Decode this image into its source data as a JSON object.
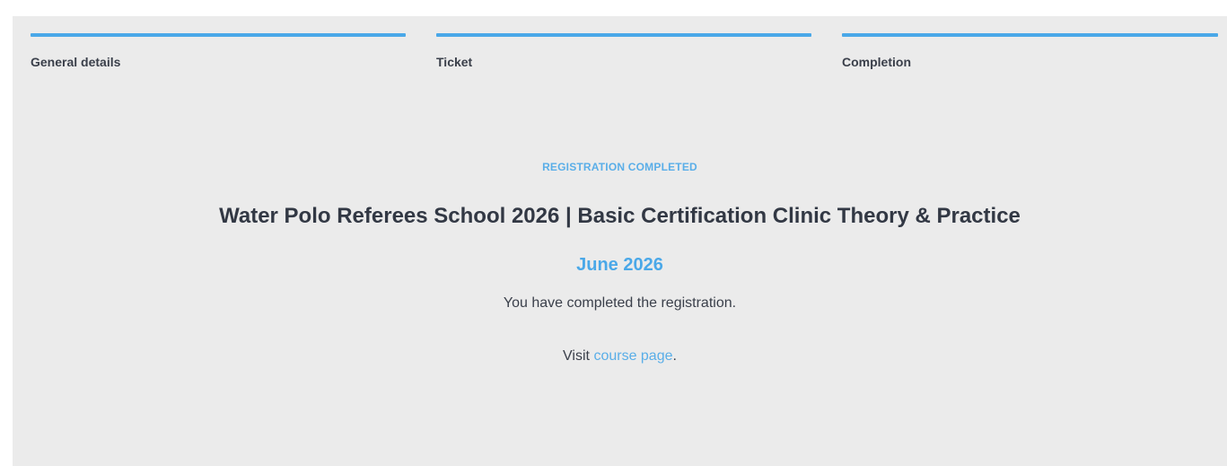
{
  "steps": [
    {
      "label": "General details",
      "active": true
    },
    {
      "label": "Ticket",
      "active": true
    },
    {
      "label": "Completion",
      "active": true
    }
  ],
  "status_label": "REGISTRATION COMPLETED",
  "course_title": "Water Polo Referees School 2026 | Basic Certification Clinic Theory & Practice",
  "course_date": "June 2026",
  "completion_message": "You have completed the registration.",
  "visit": {
    "prefix": "Visit ",
    "link_text": "course page",
    "suffix": "."
  },
  "colors": {
    "accent": "#4aa8e8",
    "panel_bg": "#ebebeb",
    "text": "#323844"
  }
}
